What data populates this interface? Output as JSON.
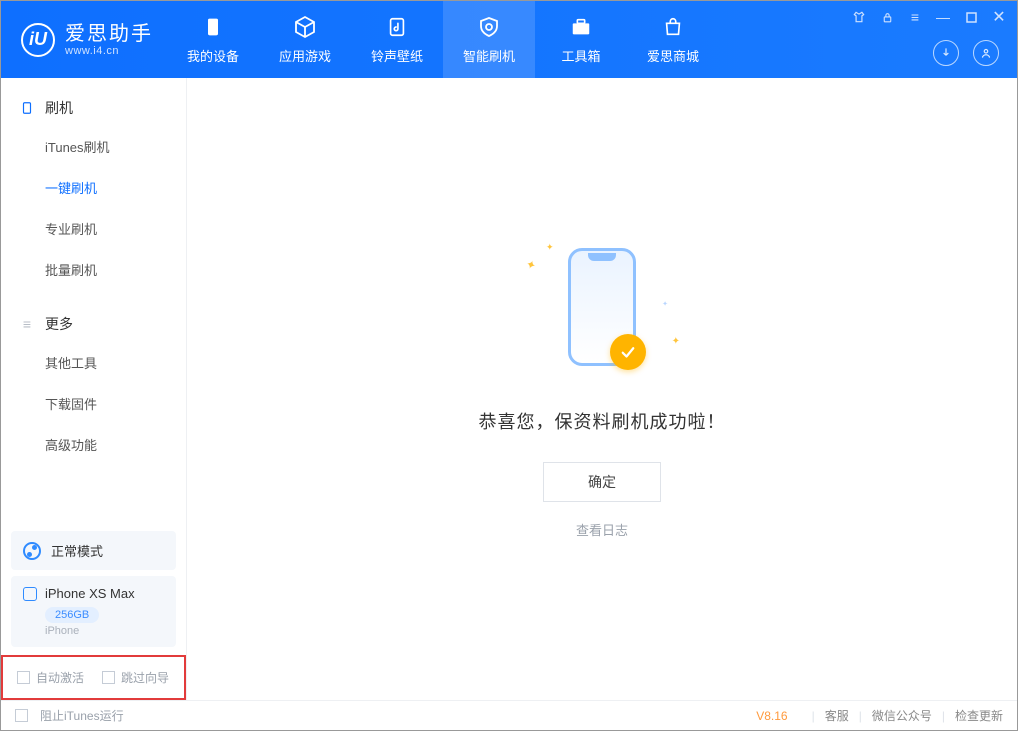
{
  "app": {
    "title": "爱思助手",
    "site": "www.i4.cn"
  },
  "nav": {
    "items": [
      {
        "label": "我的设备"
      },
      {
        "label": "应用游戏"
      },
      {
        "label": "铃声壁纸"
      },
      {
        "label": "智能刷机"
      },
      {
        "label": "工具箱"
      },
      {
        "label": "爱思商城"
      }
    ]
  },
  "sidebar": {
    "section_flash": "刷机",
    "flash_items": [
      "iTunes刷机",
      "一键刷机",
      "专业刷机",
      "批量刷机"
    ],
    "section_more": "更多",
    "more_items": [
      "其他工具",
      "下载固件",
      "高级功能"
    ],
    "mode_label": "正常模式",
    "device": {
      "name": "iPhone XS Max",
      "storage": "256GB",
      "type": "iPhone"
    },
    "options": {
      "auto_activate": "自动激活",
      "skip_guide": "跳过向导"
    }
  },
  "main": {
    "success_text": "恭喜您，保资料刷机成功啦！",
    "ok_button": "确定",
    "view_log": "查看日志"
  },
  "footer": {
    "block_itunes": "阻止iTunes运行",
    "version": "V8.16",
    "links": [
      "客服",
      "微信公众号",
      "检查更新"
    ]
  }
}
